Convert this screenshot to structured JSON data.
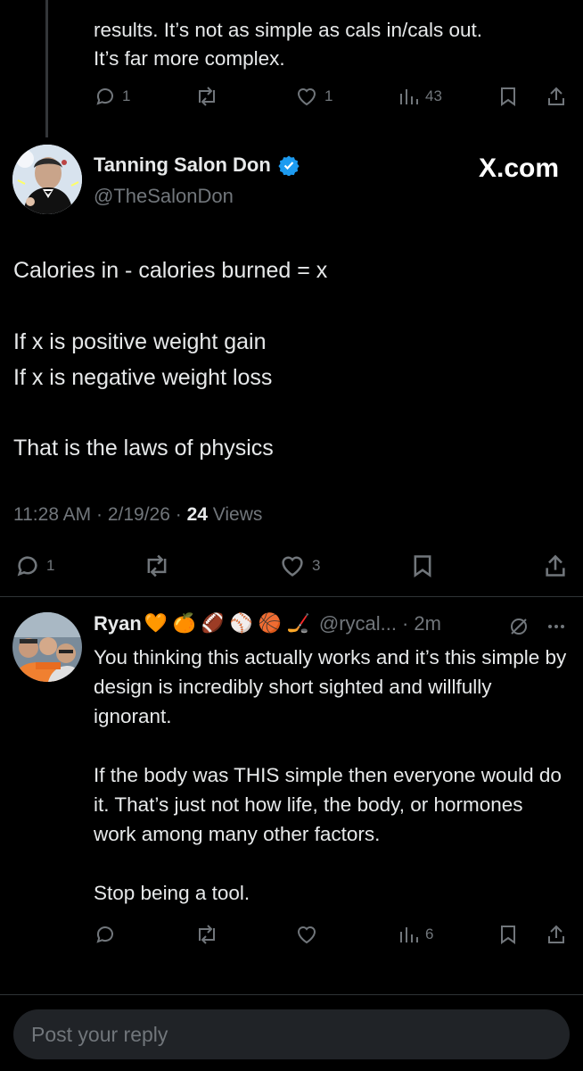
{
  "previous_reply": {
    "text_line1": "results. It’s not as simple as cals in/cals out.",
    "text_line2": "It’s far more complex.",
    "replies": "1",
    "likes": "1",
    "views": "43"
  },
  "post": {
    "author_name": "Tanning Salon Don",
    "author_handle": "@TheSalonDon",
    "source": "X.com",
    "line1": "Calories in - calories burned = x",
    "line2": "If x is positive weight gain",
    "line3": "If x is negative weight loss",
    "line4": "That is the laws of physics",
    "timestamp": "11:28 AM · 2/19/26 · ",
    "views_count": "24",
    "views_label": " Views",
    "replies": "1",
    "likes": "3"
  },
  "reply": {
    "author_name": "Ryan",
    "author_emojis": "🧡 🍊 🏈 ⚾ 🏀 🏒",
    "author_handle": "@rycal...",
    "time": "· 2m",
    "para1": "You thinking this actually works and it’s this simple by design is incredibly short sighted and willfully ignorant.",
    "para2": "If the body was THIS simple then everyone would do it. That’s just not how life, the body, or hormones work among many other factors.",
    "para3": "Stop being a tool.",
    "views": "6"
  },
  "composer": {
    "placeholder": "Post your reply"
  },
  "colors": {
    "background": "#000000",
    "text": "#e7e9ea",
    "muted": "#71767b",
    "verified": "#1d9bf0",
    "divider": "#2f3336"
  }
}
